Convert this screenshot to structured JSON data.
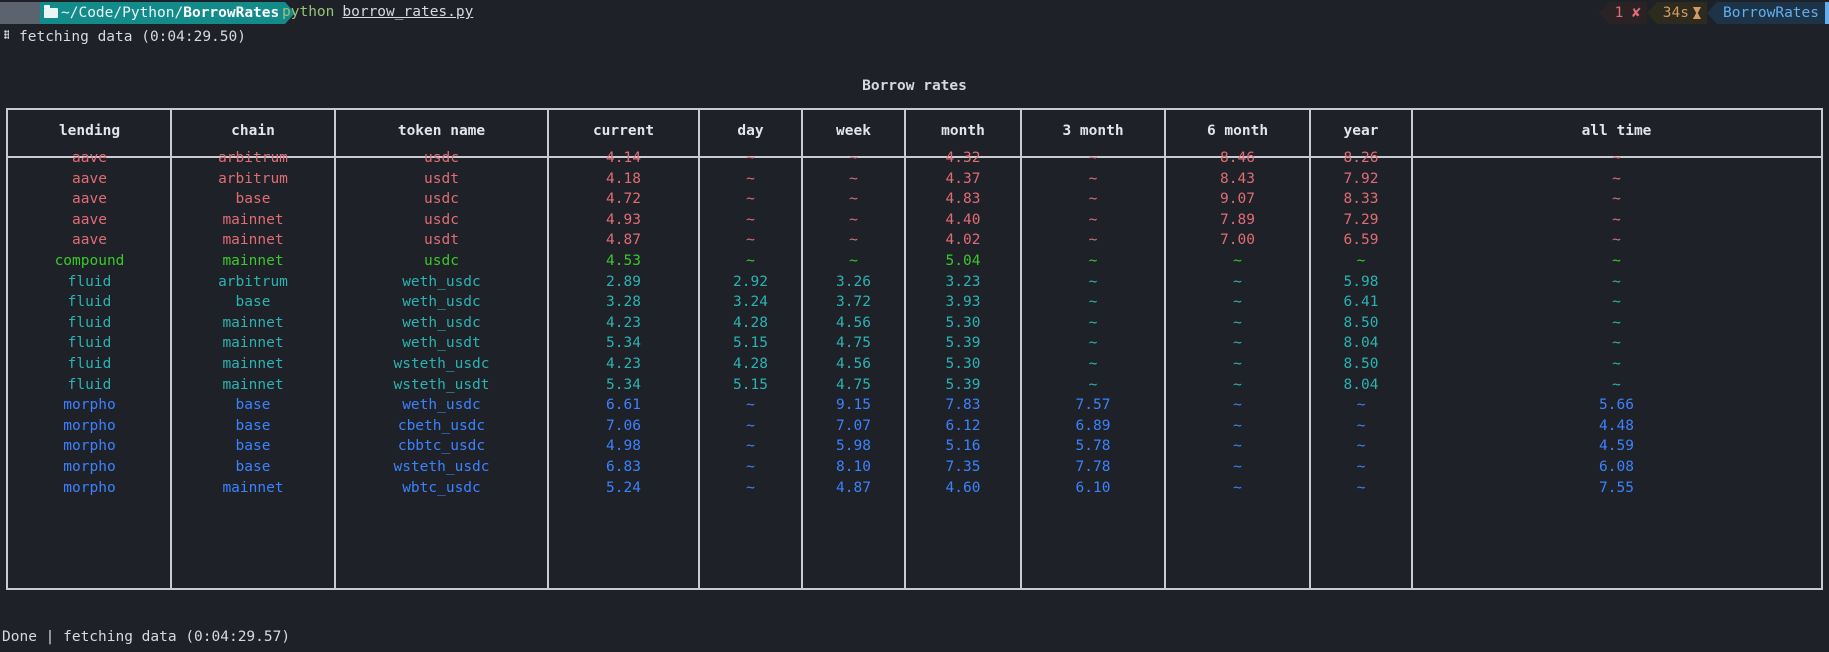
{
  "prompt": {
    "path_prefix": "~/Code/Python/",
    "path_dir": "BorrowRates",
    "command": "python",
    "argument": "borrow_rates.py",
    "exit_code": "1 ✘",
    "duration": "34s",
    "env_name": "BorrowRates"
  },
  "status_top": "fetching data (0:04:29.50)",
  "title": "Borrow rates",
  "table": {
    "columns": [
      "lending",
      "chain",
      "token name",
      "current",
      "day",
      "week",
      "month",
      "3 month",
      "6 month",
      "year",
      "all time"
    ],
    "rows": [
      {
        "color": "red",
        "cells": [
          "aave",
          "arbitrum",
          "usdc",
          "4.14",
          "~",
          "~",
          "4.32",
          "~",
          "8.46",
          "8.26",
          "~"
        ]
      },
      {
        "color": "red",
        "cells": [
          "aave",
          "arbitrum",
          "usdt",
          "4.18",
          "~",
          "~",
          "4.37",
          "~",
          "8.43",
          "7.92",
          "~"
        ]
      },
      {
        "color": "red",
        "cells": [
          "aave",
          "base",
          "usdc",
          "4.72",
          "~",
          "~",
          "4.83",
          "~",
          "9.07",
          "8.33",
          "~"
        ]
      },
      {
        "color": "red",
        "cells": [
          "aave",
          "mainnet",
          "usdc",
          "4.93",
          "~",
          "~",
          "4.40",
          "~",
          "7.89",
          "7.29",
          "~"
        ]
      },
      {
        "color": "red",
        "cells": [
          "aave",
          "mainnet",
          "usdt",
          "4.87",
          "~",
          "~",
          "4.02",
          "~",
          "7.00",
          "6.59",
          "~"
        ]
      },
      {
        "color": "green",
        "cells": [
          "compound",
          "mainnet",
          "usdc",
          "4.53",
          "~",
          "~",
          "5.04",
          "~",
          "~",
          "~",
          "~"
        ]
      },
      {
        "color": "teal",
        "cells": [
          "fluid",
          "arbitrum",
          "weth_usdc",
          "2.89",
          "2.92",
          "3.26",
          "3.23",
          "~",
          "~",
          "5.98",
          "~"
        ]
      },
      {
        "color": "teal",
        "cells": [
          "fluid",
          "base",
          "weth_usdc",
          "3.28",
          "3.24",
          "3.72",
          "3.93",
          "~",
          "~",
          "6.41",
          "~"
        ]
      },
      {
        "color": "teal",
        "cells": [
          "fluid",
          "mainnet",
          "weth_usdc",
          "4.23",
          "4.28",
          "4.56",
          "5.30",
          "~",
          "~",
          "8.50",
          "~"
        ]
      },
      {
        "color": "teal",
        "cells": [
          "fluid",
          "mainnet",
          "weth_usdt",
          "5.34",
          "5.15",
          "4.75",
          "5.39",
          "~",
          "~",
          "8.04",
          "~"
        ]
      },
      {
        "color": "teal",
        "cells": [
          "fluid",
          "mainnet",
          "wsteth_usdc",
          "4.23",
          "4.28",
          "4.56",
          "5.30",
          "~",
          "~",
          "8.50",
          "~"
        ]
      },
      {
        "color": "teal",
        "cells": [
          "fluid",
          "mainnet",
          "wsteth_usdt",
          "5.34",
          "5.15",
          "4.75",
          "5.39",
          "~",
          "~",
          "8.04",
          "~"
        ]
      },
      {
        "color": "blue",
        "cells": [
          "morpho",
          "base",
          "weth_usdc",
          "6.61",
          "~",
          "9.15",
          "7.83",
          "7.57",
          "~",
          "~",
          "5.66"
        ]
      },
      {
        "color": "blue",
        "cells": [
          "morpho",
          "base",
          "cbeth_usdc",
          "7.06",
          "~",
          "7.07",
          "6.12",
          "6.89",
          "~",
          "~",
          "4.48"
        ]
      },
      {
        "color": "blue",
        "cells": [
          "morpho",
          "base",
          "cbbtc_usdc",
          "4.98",
          "~",
          "5.98",
          "5.16",
          "5.78",
          "~",
          "~",
          "4.59"
        ]
      },
      {
        "color": "blue",
        "cells": [
          "morpho",
          "base",
          "wsteth_usdc",
          "6.83",
          "~",
          "8.10",
          "7.35",
          "7.78",
          "~",
          "~",
          "6.08"
        ]
      },
      {
        "color": "blue",
        "cells": [
          "morpho",
          "mainnet",
          "wbtc_usdc",
          "5.24",
          "~",
          "4.87",
          "4.60",
          "6.10",
          "~",
          "~",
          "7.55"
        ]
      }
    ]
  },
  "status_bottom": "Done | fetching data (0:04:29.57)",
  "colors": {
    "red": "#e06c75",
    "green": "#39c92a",
    "teal": "#2bb3b3",
    "blue": "#3c82ff"
  },
  "icons": [
    "folder-icon",
    "hourglass-icon",
    "spinner-icon"
  ]
}
